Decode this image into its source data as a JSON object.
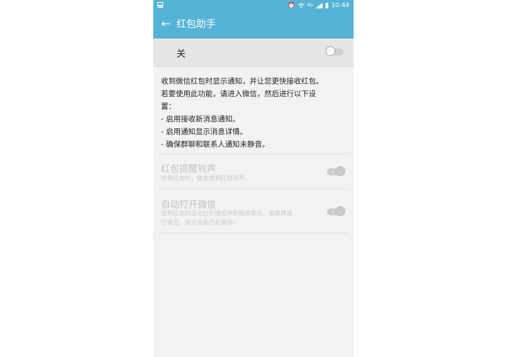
{
  "status_bar": {
    "time": "10:44",
    "icons": [
      "image-icon",
      "alarm-icon",
      "wifi-icon",
      "4g-icon",
      "signal-icon",
      "battery-icon"
    ],
    "network_label": "4G"
  },
  "app_bar": {
    "title": "红包助手",
    "back_icon": "arrow-left-icon"
  },
  "master_switch": {
    "label": "关",
    "state": "off"
  },
  "description": {
    "lines": [
      "收到微信红包时显示通知，并让您更快接收红包。",
      "若要使用此功能，请进入微信，然后进行以下设",
      "置：",
      "- 启用接收新消息通知。",
      "- 启用通知显示消息详情。",
      "- 确保群聊和联系人通知未静音。"
    ]
  },
  "settings": [
    {
      "title": "红包提醒铃声",
      "subtitle": "收到红包时，播放收到红包铃声。",
      "state": "on",
      "enabled": false
    },
    {
      "title": "自动打开微信",
      "subtitle_lines": [
        "收到红包时自动打开微信中的相关聊天。如果屏幕",
        "已锁定，则不会执行此操作。"
      ],
      "state": "on",
      "enabled": false
    }
  ],
  "colors": {
    "accent": "#55b4d6",
    "background": "#f2f2f2",
    "header_row": "#e6e6e6",
    "disabled_text": "#c2c2c2"
  }
}
